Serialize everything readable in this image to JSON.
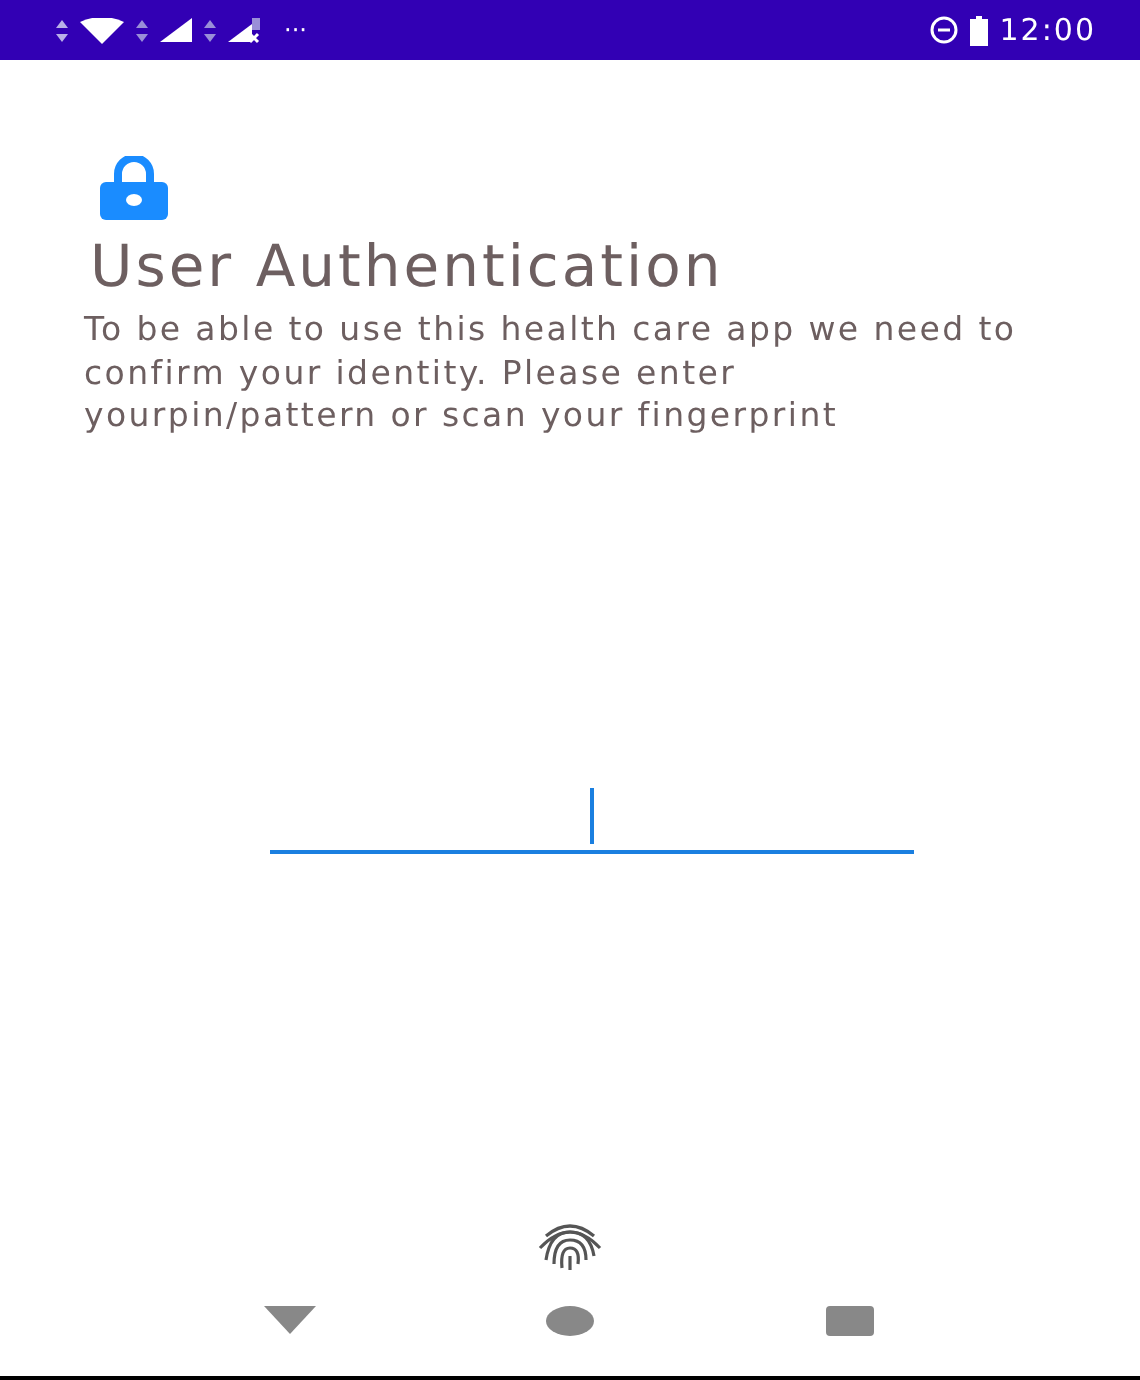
{
  "status_bar": {
    "time": "12:00",
    "overflow": "···"
  },
  "auth": {
    "title": "User Authentication",
    "message": "To be able to use this health care app we need to confirm your identity. Please enter yourpin/pattern or scan your fingerprint"
  },
  "pin_field": {
    "focused": true
  },
  "nav_bar": {
    "buttons": [
      {
        "kind": "back"
      },
      {
        "kind": "home"
      },
      {
        "kind": "recents"
      }
    ]
  }
}
